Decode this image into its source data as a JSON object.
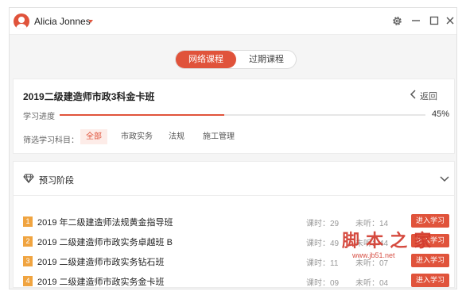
{
  "titlebar": {
    "username": "Alicia Jonnes"
  },
  "tabs": [
    {
      "label": "网络课程",
      "active": true
    },
    {
      "label": "过期课程",
      "active": false
    }
  ],
  "course": {
    "title": "2019二级建造师市政3科金卡班",
    "back_label": "返回",
    "progress_label": "学习进度",
    "progress_value": "45%",
    "progress_fraction": 0.45,
    "filter_label": "筛选学习科目：",
    "filters": [
      "全部",
      "市政实务",
      "法规",
      "施工管理"
    ],
    "active_filter": "全部"
  },
  "stage": {
    "title": "预习阶段",
    "rows": [
      {
        "num": "1",
        "title": "2019 年二级建造师法规黄金指导班",
        "hours": "课时：29",
        "unheard": "未听：14",
        "button": "进入学习"
      },
      {
        "num": "2",
        "title": "2019 二级建造师市政实务卓越班 B",
        "hours": "课时：49",
        "unheard": "未听：44",
        "button": "进入学习"
      },
      {
        "num": "3",
        "title": "2019 二级建造师市政实务钻石班",
        "hours": "课时：11",
        "unheard": "未听：07",
        "button": "进入学习"
      },
      {
        "num": "4",
        "title": "2019 二级建造师市政实务金卡班",
        "hours": "课时：09",
        "unheard": "未听：04",
        "button": "进入学习"
      }
    ]
  },
  "watermark": {
    "text": "脚 本 之 家",
    "url": "www.jb51.net"
  },
  "colors": {
    "accent": "#e0533b",
    "number_badge": "#f0a440"
  }
}
